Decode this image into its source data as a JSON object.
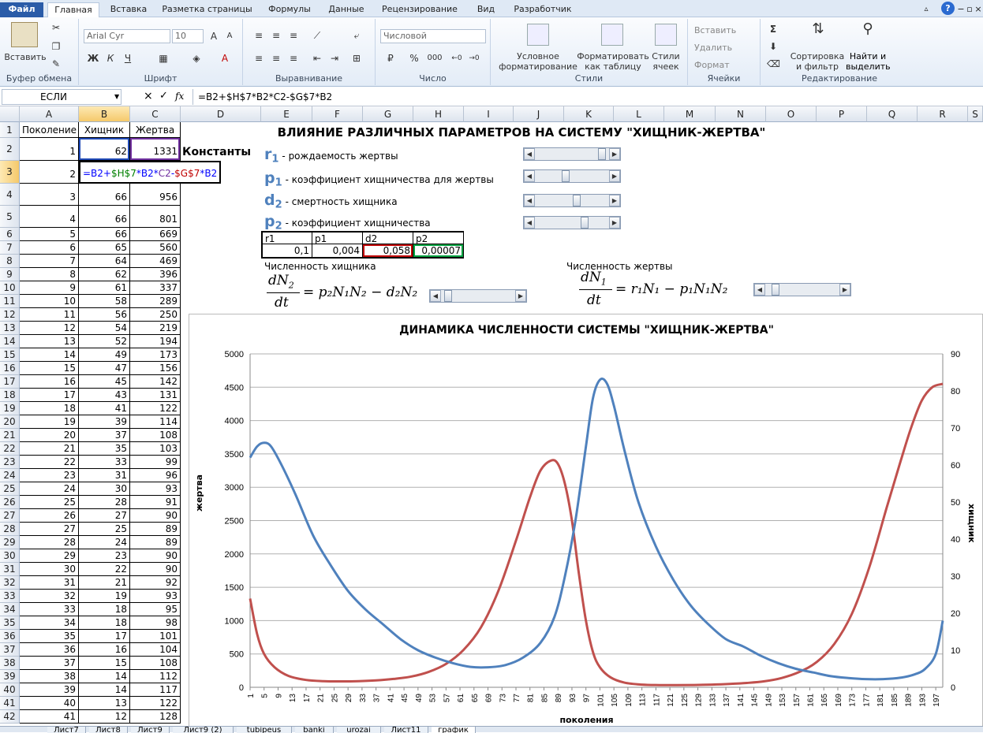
{
  "ribbon": {
    "tabs": [
      "Файл",
      "Главная",
      "Вставка",
      "Разметка страницы",
      "Формулы",
      "Данные",
      "Рецензирование",
      "Вид",
      "Разработчик"
    ],
    "groups": {
      "clipboard": "Буфер обмена",
      "font": "Шрифт",
      "align": "Выравнивание",
      "number": "Число",
      "styles": "Стили",
      "cells": "Ячейки",
      "edit": "Редактирование"
    },
    "paste": "Вставить",
    "font_name": "Arial Cyr",
    "font_size": "10",
    "number_format": "Числовой",
    "cond_format": [
      "Условное",
      "форматирование"
    ],
    "format_table": [
      "Форматировать",
      "как таблицу"
    ],
    "cell_styles": [
      "Стили",
      "ячеек"
    ],
    "insert": "Вставить",
    "delete": "Удалить",
    "format": "Формат",
    "sort": [
      "Сортировка",
      "и фильтр"
    ],
    "find": [
      "Найти и",
      "выделить"
    ],
    "icons": {
      "bold": "Ж",
      "italic": "К",
      "underline": "Ч",
      "sum": "Σ",
      "percent": "%",
      "thousands": "000"
    }
  },
  "formula_bar": {
    "name_box": "ЕСЛИ",
    "formula": "=B2+$H$7*B2*C2-$G$7*B2"
  },
  "columns": [
    "A",
    "B",
    "C",
    "D",
    "E",
    "F",
    "G",
    "H",
    "I",
    "J",
    "K",
    "L",
    "M",
    "N",
    "O",
    "P",
    "Q",
    "R",
    "S"
  ],
  "table": {
    "headers": [
      "Поколение",
      "Хищник",
      "Жертва"
    ],
    "rows": [
      [
        "1",
        "62",
        "1331"
      ],
      [
        "2",
        "",
        ""
      ],
      [
        "3",
        "66",
        "956"
      ],
      [
        "4",
        "66",
        "801"
      ],
      [
        "5",
        "66",
        "669"
      ],
      [
        "6",
        "65",
        "560"
      ],
      [
        "7",
        "64",
        "469"
      ],
      [
        "8",
        "62",
        "396"
      ],
      [
        "9",
        "61",
        "337"
      ],
      [
        "10",
        "58",
        "289"
      ],
      [
        "11",
        "56",
        "250"
      ],
      [
        "12",
        "54",
        "219"
      ],
      [
        "13",
        "52",
        "194"
      ],
      [
        "14",
        "49",
        "173"
      ],
      [
        "15",
        "47",
        "156"
      ],
      [
        "16",
        "45",
        "142"
      ],
      [
        "17",
        "43",
        "131"
      ],
      [
        "18",
        "41",
        "122"
      ],
      [
        "19",
        "39",
        "114"
      ],
      [
        "20",
        "37",
        "108"
      ],
      [
        "21",
        "35",
        "103"
      ],
      [
        "22",
        "33",
        "99"
      ],
      [
        "23",
        "31",
        "96"
      ],
      [
        "24",
        "30",
        "93"
      ],
      [
        "25",
        "28",
        "91"
      ],
      [
        "26",
        "27",
        "90"
      ],
      [
        "27",
        "25",
        "89"
      ],
      [
        "28",
        "24",
        "89"
      ],
      [
        "29",
        "23",
        "90"
      ],
      [
        "30",
        "22",
        "90"
      ],
      [
        "31",
        "21",
        "92"
      ],
      [
        "32",
        "19",
        "93"
      ],
      [
        "33",
        "18",
        "95"
      ],
      [
        "34",
        "18",
        "98"
      ],
      [
        "35",
        "17",
        "101"
      ],
      [
        "36",
        "16",
        "104"
      ],
      [
        "37",
        "15",
        "108"
      ],
      [
        "38",
        "14",
        "112"
      ],
      [
        "39",
        "14",
        "117"
      ],
      [
        "40",
        "13",
        "122"
      ],
      [
        "41",
        "12",
        "128"
      ]
    ],
    "edit_formula": [
      {
        "t": "=B2+",
        "c": "#0000ff"
      },
      {
        "t": "$H$7",
        "c": "#008000"
      },
      {
        "t": "*B2*",
        "c": "#0000ff"
      },
      {
        "t": "C2",
        "c": "#7030a0"
      },
      {
        "t": "-",
        "c": "#0000ff"
      },
      {
        "t": "$G$7",
        "c": "#c00000"
      },
      {
        "t": "*B2",
        "c": "#0000ff"
      }
    ]
  },
  "constants_label": "Константы",
  "title": "ВЛИЯНИЕ РАЗЛИЧНЫХ ПАРАМЕТРОВ НА СИСТЕМУ \"ХИЩНИК-ЖЕРТВА\"",
  "params": [
    {
      "sym": "r",
      "sub": "1",
      "desc": "- рождаемость жертвы"
    },
    {
      "sym": "p",
      "sub": "1",
      "desc": "- коэффициент хищничества для жертвы"
    },
    {
      "sym": "d",
      "sub": "2",
      "desc": "- смертность хищника"
    },
    {
      "sym": "p",
      "sub": "2",
      "desc": "- коэффициент хищничества"
    }
  ],
  "param_table": {
    "headers": [
      "r1",
      "p1",
      "d2",
      "p2"
    ],
    "values": [
      "0,1",
      "0,004",
      "0,058",
      "0,00007"
    ]
  },
  "eq_labels": {
    "predator": "Численность хищника",
    "prey": "Численность жертвы"
  },
  "eq_predator": {
    "lhs_num": "dN",
    "lhs_sub": "2",
    "lhs_den": "dt",
    "rhs": "= p₂N₁N₂ − d₂N₂"
  },
  "eq_prey": {
    "lhs_num": "dN",
    "lhs_sub": "1",
    "lhs_den": "dt",
    "rhs": "= r₁N₁ − p₁N₁N₂"
  },
  "sheet_tabs": [
    "Лист7",
    "Лист8",
    "Лист9",
    "Лист9 (2)",
    "tubipeus",
    "banki",
    "urozai",
    "Лист11",
    "график"
  ],
  "chart_data": {
    "type": "line",
    "title": "ДИНАМИКА ЧИСЛЕННОСТИ СИСТЕМЫ \"ХИЩНИК-ЖЕРТВА\"",
    "xlabel": "поколения",
    "ylabel": "жертва",
    "y2label": "хищник",
    "ylim": [
      0,
      5000
    ],
    "yticks": [
      0,
      500,
      1000,
      1500,
      2000,
      2500,
      3000,
      3500,
      4000,
      4500,
      5000
    ],
    "y2lim": [
      0,
      90
    ],
    "y2ticks": [
      0,
      10,
      20,
      30,
      40,
      50,
      60,
      70,
      80,
      90
    ],
    "xticks": [
      1,
      5,
      9,
      13,
      17,
      21,
      25,
      29,
      33,
      37,
      41,
      45,
      49,
      53,
      57,
      61,
      65,
      69,
      73,
      77,
      81,
      85,
      89,
      93,
      97,
      101,
      105,
      109,
      113,
      117,
      121,
      125,
      129,
      133,
      137,
      141,
      145,
      149,
      153,
      157,
      161,
      165,
      169,
      173,
      177,
      181,
      185,
      189,
      193,
      197
    ],
    "grid": true,
    "series": [
      {
        "name": "жертва",
        "axis": "left",
        "color": "#c0504d",
        "x": [
          1,
          3,
          5,
          8,
          12,
          17,
          22,
          27,
          32,
          37,
          42,
          47,
          52,
          57,
          62,
          67,
          72,
          77,
          81,
          84,
          87,
          89,
          91,
          93,
          95,
          97,
          99,
          101,
          104,
          108,
          113,
          118,
          123,
          128,
          133,
          138,
          143,
          148,
          153,
          158,
          163,
          168,
          173,
          178,
          183,
          187,
          190,
          193,
          196,
          199
        ],
        "values": [
          1331,
          800,
          500,
          300,
          170,
          110,
          92,
          89,
          92,
          103,
          125,
          160,
          230,
          350,
          560,
          900,
          1450,
          2200,
          2850,
          3250,
          3400,
          3350,
          3050,
          2500,
          1700,
          1000,
          530,
          300,
          150,
          70,
          40,
          33,
          32,
          34,
          40,
          50,
          65,
          90,
          140,
          230,
          380,
          650,
          1100,
          1800,
          2700,
          3400,
          3900,
          4300,
          4500,
          4550
        ]
      },
      {
        "name": "хищник",
        "axis": "right",
        "color": "#4f81bd",
        "x": [
          1,
          3,
          5,
          7,
          10,
          14,
          19,
          24,
          29,
          34,
          39,
          44,
          49,
          54,
          59,
          64,
          69,
          74,
          79,
          84,
          88,
          91,
          94,
          97,
          99,
          101,
          103,
          105,
          108,
          112,
          117,
          122,
          127,
          132,
          137,
          142,
          147,
          152,
          157,
          162,
          167,
          172,
          177,
          182,
          187,
          191,
          194,
          197,
          199
        ],
        "values": [
          62,
          65,
          66,
          65,
          60,
          52,
          41,
          33,
          26,
          21,
          17,
          13,
          10,
          8,
          6.5,
          5.5,
          5.4,
          6,
          8,
          12,
          19,
          30,
          45,
          65,
          78,
          83,
          82,
          76,
          64,
          50,
          38,
          29,
          22,
          17,
          13,
          11,
          8.5,
          6.5,
          5,
          4,
          3,
          2.5,
          2.2,
          2.2,
          2.6,
          3.5,
          5,
          9,
          18
        ]
      }
    ]
  }
}
